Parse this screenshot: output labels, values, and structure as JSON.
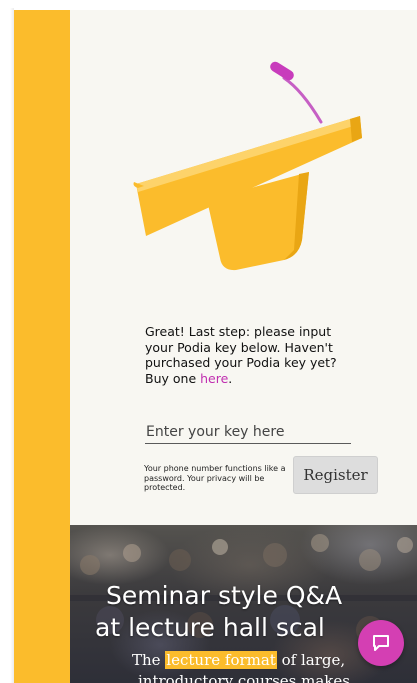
{
  "instructions": {
    "text_before_link": "Great! Last step: please input your Podia key below. Haven't purchased your Podia key yet? Buy one ",
    "link_text": "here",
    "text_after_link": "."
  },
  "key_input": {
    "placeholder": "Enter your key here",
    "value": ""
  },
  "privacy_note": "Your phone number functions like a password. Your privacy will be protected.",
  "register_label": "Register",
  "hero": {
    "title_line1": "Seminar style Q&A",
    "title_line2": "at lecture hall scal",
    "body_pre": "The ",
    "body_highlight": "lecture format",
    "body_post": " of large,",
    "body_line2": "introductory courses makes"
  },
  "colors": {
    "accent_yellow": "#fbbc2c",
    "link_magenta": "#c02fb0",
    "chat_magenta": "#d43fb3"
  },
  "icons": {
    "podium": "podium-illustration",
    "chat": "chat-bubble-icon"
  }
}
